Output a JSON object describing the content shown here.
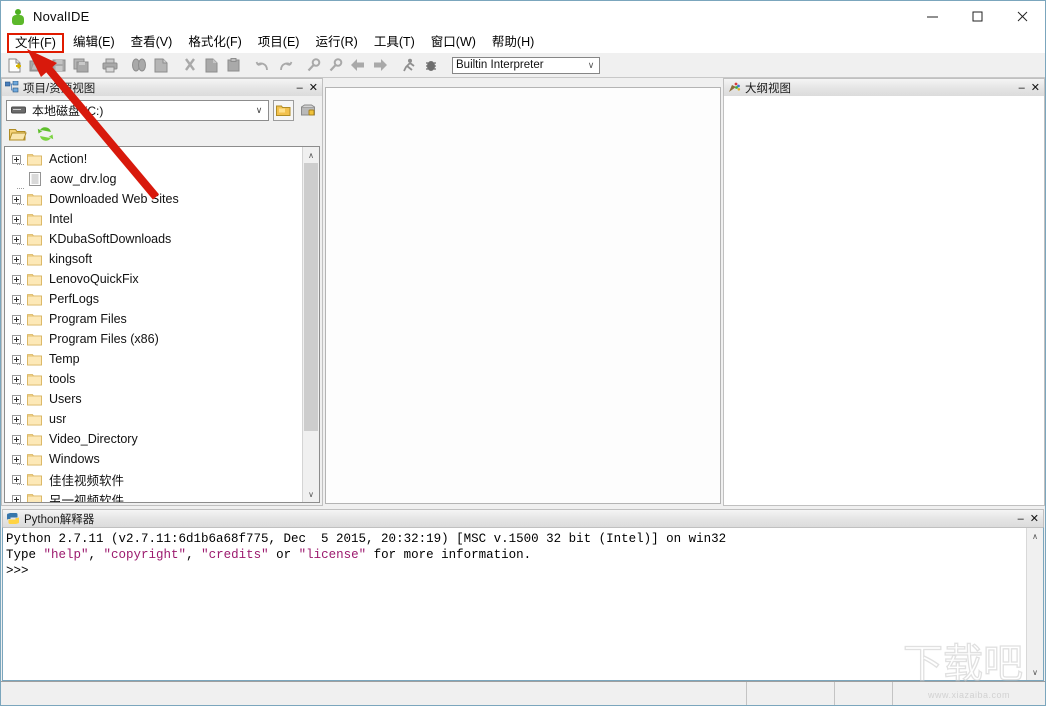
{
  "window": {
    "title": "NovalIDE",
    "icon": "novalide-logo-icon",
    "minimize_label": "—",
    "maximize_label": "□",
    "close_label": "✕"
  },
  "menubar": {
    "items": [
      {
        "label": "文件(F)",
        "name": "menu-file",
        "highlighted": true
      },
      {
        "label": "编辑(E)",
        "name": "menu-edit",
        "highlighted": false
      },
      {
        "label": "查看(V)",
        "name": "menu-view",
        "highlighted": false
      },
      {
        "label": "格式化(F)",
        "name": "menu-format",
        "highlighted": false
      },
      {
        "label": "项目(E)",
        "name": "menu-project",
        "highlighted": false
      },
      {
        "label": "运行(R)",
        "name": "menu-run",
        "highlighted": false
      },
      {
        "label": "工具(T)",
        "name": "menu-tools",
        "highlighted": false
      },
      {
        "label": "窗口(W)",
        "name": "menu-window",
        "highlighted": false
      },
      {
        "label": "帮助(H)",
        "name": "menu-help",
        "highlighted": false
      }
    ]
  },
  "toolbar": {
    "buttons": [
      {
        "name": "new-file-icon",
        "tip": "New"
      },
      {
        "name": "open-file-icon",
        "tip": "Open"
      },
      {
        "name": "save-file-icon",
        "tip": "Save"
      },
      {
        "name": "save-all-icon",
        "tip": "Save All"
      },
      {
        "name": "print-icon",
        "tip": "Print"
      },
      {
        "name": "find-icon",
        "tip": "Find"
      },
      {
        "name": "find-in-files-icon",
        "tip": "Find in Files"
      },
      {
        "name": "cut-icon",
        "tip": "Cut"
      },
      {
        "name": "copy-icon",
        "tip": "Copy"
      },
      {
        "name": "paste-icon",
        "tip": "Paste"
      },
      {
        "name": "undo-icon",
        "tip": "Undo"
      },
      {
        "name": "redo-icon",
        "tip": "Redo"
      },
      {
        "name": "zoom-in-icon",
        "tip": "Zoom In"
      },
      {
        "name": "zoom-out-icon",
        "tip": "Zoom Out"
      },
      {
        "name": "back-arrow-icon",
        "tip": "Back"
      },
      {
        "name": "forward-arrow-icon",
        "tip": "Forward"
      },
      {
        "name": "run-icon",
        "tip": "Run"
      },
      {
        "name": "debug-icon",
        "tip": "Debug"
      }
    ],
    "interpreter": {
      "value": "Builtin Interpreter",
      "arrow": "∨"
    }
  },
  "project_panel": {
    "caption": "项目/资源视图",
    "caption_icon": "project-view-icon",
    "minimize_label": "–",
    "close_label": "✕",
    "drive_selector": {
      "value": "本地磁盘 (C:)",
      "icon": "hard-drive-icon",
      "arrow": "∨"
    },
    "side_buttons": [
      {
        "name": "browse-folder-button",
        "icon": "folder-gold-icon"
      },
      {
        "name": "package-button",
        "icon": "package-lock-icon"
      }
    ],
    "tool_buttons": [
      {
        "name": "open-folder-button",
        "icon": "open-folder-icon"
      },
      {
        "name": "refresh-button",
        "icon": "refresh-green-icon"
      }
    ],
    "tree": [
      {
        "label": "Action!",
        "type": "folder",
        "expandable": true
      },
      {
        "label": "aow_drv.log",
        "type": "file",
        "expandable": false
      },
      {
        "label": "Downloaded Web Sites",
        "type": "folder",
        "expandable": true
      },
      {
        "label": "Intel",
        "type": "folder",
        "expandable": true
      },
      {
        "label": "KDubaSoftDownloads",
        "type": "folder",
        "expandable": true
      },
      {
        "label": "kingsoft",
        "type": "folder",
        "expandable": true
      },
      {
        "label": "LenovoQuickFix",
        "type": "folder",
        "expandable": true
      },
      {
        "label": "PerfLogs",
        "type": "folder",
        "expandable": true
      },
      {
        "label": "Program Files",
        "type": "folder",
        "expandable": true
      },
      {
        "label": "Program Files (x86)",
        "type": "folder",
        "expandable": true
      },
      {
        "label": "Temp",
        "type": "folder",
        "expandable": true
      },
      {
        "label": "tools",
        "type": "folder",
        "expandable": true
      },
      {
        "label": "Users",
        "type": "folder",
        "expandable": true
      },
      {
        "label": "usr",
        "type": "folder",
        "expandable": true
      },
      {
        "label": "Video_Directory",
        "type": "folder",
        "expandable": true
      },
      {
        "label": "Windows",
        "type": "folder",
        "expandable": true
      },
      {
        "label": "佳佳视频软件",
        "type": "folder",
        "expandable": true
      },
      {
        "label": "另一视频软件",
        "type": "folder",
        "expandable": true
      }
    ],
    "scroll": {
      "up_arrow": "∧",
      "down_arrow": "∨"
    }
  },
  "outline_panel": {
    "caption": "大纲视图",
    "caption_icon": "outline-view-icon",
    "minimize_label": "–",
    "close_label": "✕"
  },
  "console_panel": {
    "caption": "Python解释器",
    "caption_icon": "python-icon",
    "minimize_label": "–",
    "close_label": "✕",
    "lines": [
      {
        "segments": [
          {
            "text": "Python 2.7.11 (v2.7.11:6d1b6a68f775, Dec  5 2015, 20:32:19) [MSC v.1500 32 bit (Intel)] on win32",
            "style": "plain"
          }
        ]
      },
      {
        "segments": [
          {
            "text": "Type ",
            "style": "plain"
          },
          {
            "text": "\"help\"",
            "style": "string"
          },
          {
            "text": ", ",
            "style": "plain"
          },
          {
            "text": "\"copyright\"",
            "style": "string"
          },
          {
            "text": ", ",
            "style": "plain"
          },
          {
            "text": "\"credits\"",
            "style": "string"
          },
          {
            "text": " or ",
            "style": "plain"
          },
          {
            "text": "\"license\"",
            "style": "string"
          },
          {
            "text": " for more information.",
            "style": "plain"
          }
        ]
      },
      {
        "segments": [
          {
            "text": ">>>",
            "style": "plain"
          }
        ]
      }
    ],
    "scroll": {
      "up_arrow": "∧",
      "down_arrow": "∨"
    }
  },
  "statusbar": {
    "cells": [
      "",
      "",
      "",
      ""
    ]
  },
  "annotation": {
    "arrow_color": "#d8190c",
    "highlight_color": "#e01b00",
    "target": "文件(F)"
  },
  "watermark": {
    "logo_text": "下载吧",
    "url_text": "www.xiazaiba.com"
  },
  "colors": {
    "window_border": "#7ba6bd",
    "toolbar_bg": "#f0f0f0",
    "caption_bg": "#e4e4e4",
    "console_string": "#9c1a6e",
    "folder_gold": "#f9d77f"
  }
}
